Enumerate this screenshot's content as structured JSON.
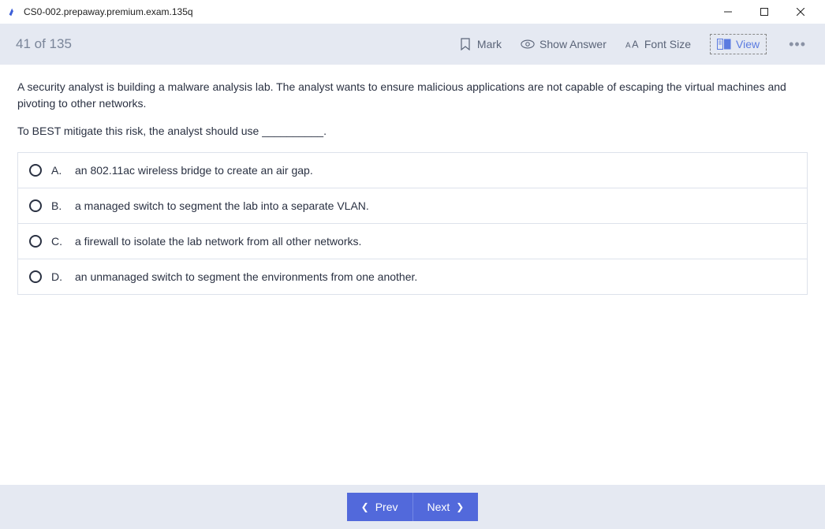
{
  "window": {
    "title": "CS0-002.prepaway.premium.exam.135q"
  },
  "toolbar": {
    "counter": "41 of 135",
    "mark": "Mark",
    "show_answer": "Show Answer",
    "font_size": "Font Size",
    "view": "View"
  },
  "question": {
    "text": "A security analyst is building a malware analysis lab. The analyst wants to ensure malicious applications are not capable of escaping the virtual machines and pivoting to other networks.",
    "prompt": "To BEST mitigate this risk, the analyst should use __________."
  },
  "answers": [
    {
      "letter": "A.",
      "text": "an 802.11ac wireless bridge to create an air gap."
    },
    {
      "letter": "B.",
      "text": "a managed switch to segment the lab into a separate VLAN."
    },
    {
      "letter": "C.",
      "text": "a firewall to isolate the lab network from all other networks."
    },
    {
      "letter": "D.",
      "text": "an unmanaged switch to segment the environments from one another."
    }
  ],
  "nav": {
    "prev": "Prev",
    "next": "Next"
  }
}
